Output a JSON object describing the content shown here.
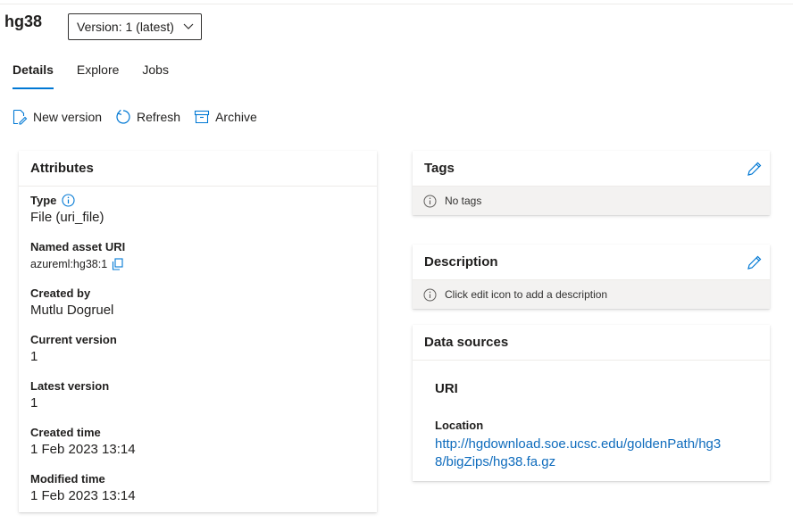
{
  "asset": {
    "name": "hg38",
    "version_label": "Version: 1 (latest)"
  },
  "tabs": [
    {
      "label": "Details"
    },
    {
      "label": "Explore"
    },
    {
      "label": "Jobs"
    }
  ],
  "commands": {
    "new_version": "New version",
    "refresh": "Refresh",
    "archive": "Archive"
  },
  "attributes": {
    "heading": "Attributes",
    "type_label": "Type",
    "type_value": "File (uri_file)",
    "uri_label": "Named asset URI",
    "uri_value": "azureml:hg38:1",
    "created_by_label": "Created by",
    "created_by_value": "Mutlu Dogruel",
    "current_version_label": "Current version",
    "current_version_value": "1",
    "latest_version_label": "Latest version",
    "latest_version_value": "1",
    "created_time_label": "Created time",
    "created_time_value": "1 Feb 2023 13:14",
    "modified_time_label": "Modified time",
    "modified_time_value": "1 Feb 2023 13:14"
  },
  "tags": {
    "heading": "Tags",
    "empty_text": "No tags"
  },
  "description": {
    "heading": "Description",
    "empty_text": "Click edit icon to add a description"
  },
  "data_sources": {
    "heading": "Data sources",
    "uri_heading": "URI",
    "location_label": "Location",
    "location_line1": "http://hgdownload.soe.ucsc.edu/goldenPath/hg3",
    "location_line2": "8/bigZips/hg38.fa.gz"
  },
  "colors": {
    "accent": "#0078d4",
    "link": "#0f6cbd",
    "infobar_bg": "#f3f2f1"
  }
}
